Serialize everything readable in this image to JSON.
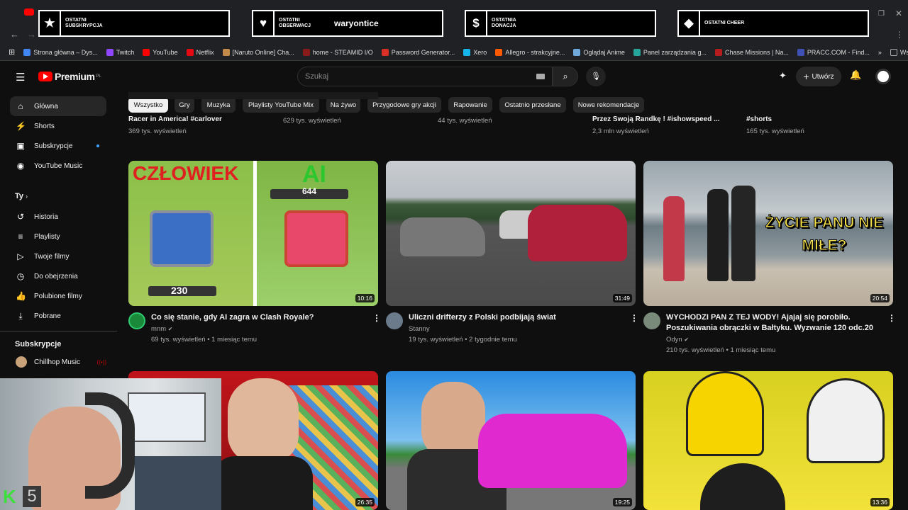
{
  "overlays": [
    {
      "icon": "star-icon",
      "label": "OSTATNI SUBSKRYPCJA",
      "value": ""
    },
    {
      "icon": "heart-icon",
      "label": "OSTATNI OBSERWACJ",
      "value": "waryontice"
    },
    {
      "icon": "dollar-icon",
      "label": "OSTATNIA DONACJA",
      "value": ""
    },
    {
      "icon": "diamond-icon",
      "label": "OSTATNI CHEER",
      "value": ""
    }
  ],
  "bookmarks": [
    {
      "label": "Strona główna – Dys...",
      "color": "#4285f4"
    },
    {
      "label": "Twitch",
      "color": "#9146ff"
    },
    {
      "label": "YouTube",
      "color": "#ff0000"
    },
    {
      "label": "Netflix",
      "color": "#e50914"
    },
    {
      "label": "[Naruto Online] Cha...",
      "color": "#c48a4a"
    },
    {
      "label": "home - STEAMID I/O",
      "color": "#8b1a1a"
    },
    {
      "label": "Password Generator...",
      "color": "#d93025"
    },
    {
      "label": "Xero",
      "color": "#13b5ea"
    },
    {
      "label": "Allegro - strakcyjne...",
      "color": "#ff5a00"
    },
    {
      "label": "Oglądaj Anime",
      "color": "#6fa8dc"
    },
    {
      "label": "Panel zarządzania g...",
      "color": "#26a69a"
    },
    {
      "label": "Chase Missions | Na...",
      "color": "#b71c1c"
    },
    {
      "label": "PRACC.COM - Find...",
      "color": "#3f51b5"
    }
  ],
  "bookmarks_all": "Wszystkie zakładki",
  "masthead": {
    "logo": "Premium",
    "logo_sup": "PL",
    "search_placeholder": "Szukaj",
    "create": "Utwórz"
  },
  "sidebar": {
    "items": [
      {
        "label": "Główna",
        "icon": "home-icon",
        "glyph": "⌂"
      },
      {
        "label": "Shorts",
        "icon": "shorts-icon",
        "glyph": "⚡"
      },
      {
        "label": "Subskrypcje",
        "icon": "subscriptions-icon",
        "glyph": "▣"
      },
      {
        "label": "YouTube Music",
        "icon": "music-icon",
        "glyph": "◉"
      }
    ],
    "you_header": "Ty",
    "you_items": [
      {
        "label": "Historia",
        "icon": "history-icon",
        "glyph": "↺"
      },
      {
        "label": "Playlisty",
        "icon": "playlist-icon",
        "glyph": "≡"
      },
      {
        "label": "Twoje filmy",
        "icon": "your-videos-icon",
        "glyph": "▷"
      },
      {
        "label": "Do obejrzenia",
        "icon": "watch-later-icon",
        "glyph": "◷"
      },
      {
        "label": "Polubione filmy",
        "icon": "like-icon",
        "glyph": "👍"
      },
      {
        "label": "Pobrane",
        "icon": "download-icon",
        "glyph": "⤓"
      }
    ],
    "subs_header": "Subskrypcje",
    "subs": [
      {
        "label": "Chillhop Music"
      }
    ]
  },
  "chips": [
    "Wszystko",
    "Gry",
    "Muzyka",
    "Playlisty YouTube Mix",
    "Na żywo",
    "Przygodowe gry akcji",
    "Rapowanie",
    "Ostatnio przesłane",
    "Nowe rekomendacje"
  ],
  "prev_row": [
    {
      "title": "Racer in America! #carlover",
      "meta": "369 tys. wyświetleń"
    },
    {
      "title": "",
      "meta": "629 tys. wyświetleń"
    },
    {
      "title": "",
      "meta": "44 tys. wyświetleń"
    },
    {
      "title": "Przez Swoją Randkę ! #ishowspeed ...",
      "meta": "2,3 mln wyświetleń"
    },
    {
      "title": "#shorts",
      "meta": "165 tys. wyświetleń"
    }
  ],
  "videos": [
    {
      "title": "Co się stanie, gdy AI zagra w Clash Royale?",
      "channel": "mnm",
      "meta": "69 tys. wyświetleń • 1 miesiąc temu",
      "duration": "10:16",
      "thumb_left": "CZŁOWIEK",
      "thumb_right": "AI",
      "score_a": "230",
      "score_b": "644"
    },
    {
      "title": "Uliczni drifterzy z Polski podbijają świat",
      "channel": "Stanny",
      "meta": "19 tys. wyświetleń • 2 tygodnie temu",
      "duration": "31:49"
    },
    {
      "title": "WYCHODZI PAN Z TEJ WODY! Ajajaj się porobiło. Poszukiwania obrączki w Bałtyku. Wyzwanie 120 odc.20",
      "channel": "Odyn",
      "meta": "210 tys. wyświetleń • 1 miesiąc temu",
      "duration": "20:54",
      "overlay": "ŻYCIE PANU NIE MIŁE?"
    }
  ],
  "row2_durations": [
    "26:35",
    "19:25",
    "13:36"
  ],
  "webcam_badge": "5"
}
